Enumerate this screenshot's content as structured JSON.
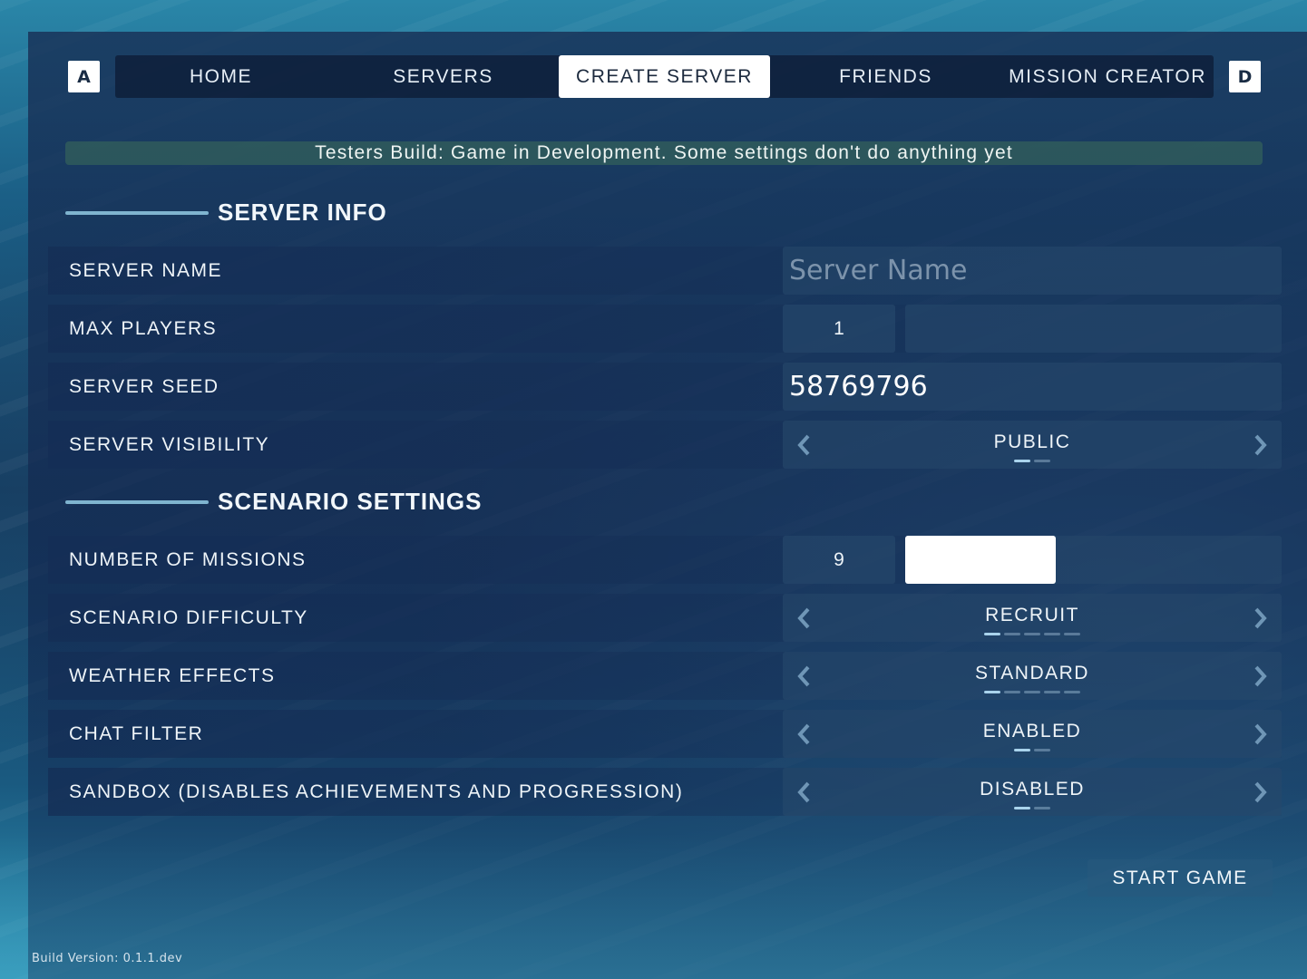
{
  "nav": {
    "left_key": "A",
    "right_key": "D",
    "tabs": [
      {
        "label": "HOME",
        "active": false
      },
      {
        "label": "SERVERS",
        "active": false
      },
      {
        "label": "CREATE SERVER",
        "active": true
      },
      {
        "label": "FRIENDS",
        "active": false
      },
      {
        "label": "MISSION CREATOR",
        "active": false
      }
    ]
  },
  "banner": "Testers Build: Game in Development. Some settings don't do anything yet",
  "sections": {
    "server_info": "SERVER INFO",
    "scenario_settings": "SCENARIO SETTINGS"
  },
  "server_name": {
    "label": "SERVER NAME",
    "value": "",
    "placeholder": "Server Name"
  },
  "max_players": {
    "label": "MAX PLAYERS",
    "value": "1",
    "slider_fraction": 0.0
  },
  "server_seed": {
    "label": "SERVER SEED",
    "value": "58769796"
  },
  "server_visibility": {
    "label": "SERVER VISIBILITY",
    "value": "PUBLIC",
    "option_index": 0,
    "option_count": 2
  },
  "number_of_missions": {
    "label": "NUMBER OF MISSIONS",
    "value": "9",
    "slider_fraction": 0.4
  },
  "scenario_difficulty": {
    "label": "SCENARIO DIFFICULTY",
    "value": "RECRUIT",
    "option_index": 0,
    "option_count": 5
  },
  "weather_effects": {
    "label": "WEATHER EFFECTS",
    "value": "STANDARD",
    "option_index": 0,
    "option_count": 5
  },
  "chat_filter": {
    "label": "CHAT FILTER",
    "value": "ENABLED",
    "option_index": 0,
    "option_count": 2
  },
  "sandbox": {
    "label": "SANDBOX (DISABLES ACHIEVEMENTS AND PROGRESSION)",
    "value": "DISABLED",
    "option_index": 0,
    "option_count": 2
  },
  "start_button": "START GAME",
  "build_version": "Build Version: 0.1.1.dev",
  "colors": {
    "accent_line": "#7fb4cf",
    "active_tab_bg": "#ffffff",
    "banner_bg": "#3c6e5a"
  },
  "icons": {
    "prev": "chevron-left-icon",
    "next": "chevron-right-icon"
  }
}
